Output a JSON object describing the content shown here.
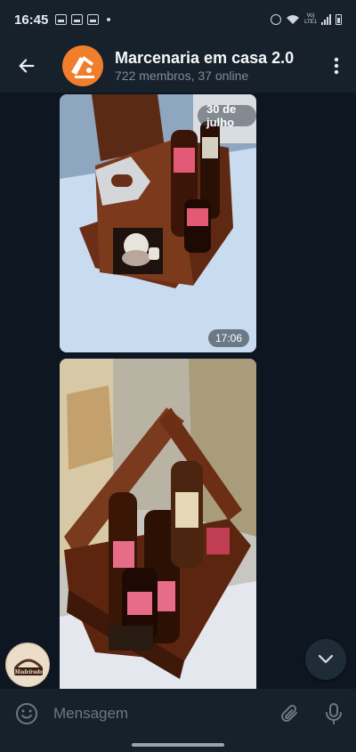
{
  "status_bar": {
    "time": "16:45",
    "network": [
      "Vo)",
      "LTE1"
    ]
  },
  "header": {
    "title": "Marcenaria em casa 2.0",
    "subtitle": "722 membros, 37 online",
    "avatar_color": "#f07e2d"
  },
  "messages": [
    {
      "type": "photo",
      "date_label": "30 de julho",
      "time": "17:06",
      "subject": "wooden beer caddy with bottle opener and sticker"
    },
    {
      "type": "photo",
      "subject": "wooden beer caddy holding beer bottles"
    }
  ],
  "sender_avatar": {
    "label": "Madeirado"
  },
  "input": {
    "placeholder": "Mensagem"
  },
  "colors": {
    "background": "#0e1621",
    "bar": "#17212b",
    "muted_text": "#7c8c9c"
  }
}
